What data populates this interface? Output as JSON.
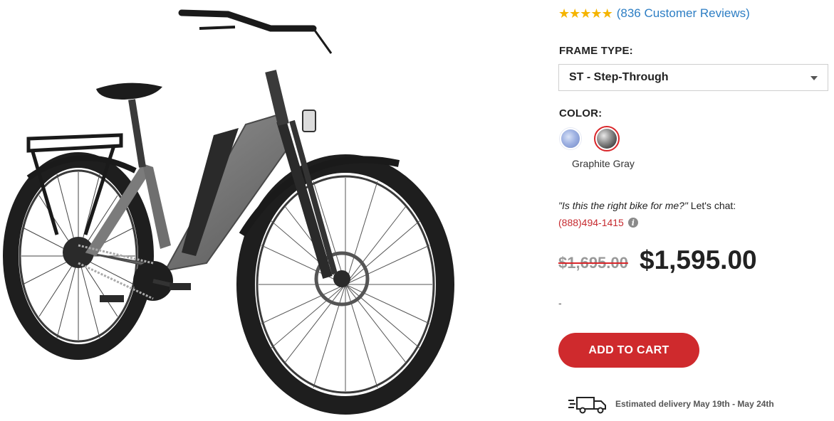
{
  "product": {
    "image_alt": "Graphite gray step-through electric bike"
  },
  "rating": {
    "stars": 5,
    "star_glyph": "★",
    "reviews_text": "(836 Customer Reviews)",
    "star_color": "#f5b400",
    "link_color": "#2d7ec4"
  },
  "frame": {
    "label": "FRAME TYPE:",
    "selected": "ST - Step-Through"
  },
  "color": {
    "label": "COLOR:",
    "options": [
      {
        "name": "Blue",
        "swatch": "#8fa3dc"
      },
      {
        "name": "Graphite Gray",
        "swatch": "#6b6b6b",
        "selected": true
      }
    ],
    "selected_name": "Graphite Gray"
  },
  "chat": {
    "question": "\"Is this the right bike for me?\"",
    "suffix": " Let's chat:",
    "phone": "(888)494-1415",
    "info_glyph": "i"
  },
  "price": {
    "original": "$1,695.00",
    "sale": "$1,595.00"
  },
  "misc": {
    "dash": "-"
  },
  "cart": {
    "button_label": "ADD TO CART",
    "button_color": "#cf2a2d"
  },
  "delivery": {
    "text": "Estimated delivery May 19th - May 24th",
    "icon": "delivery-truck-icon"
  }
}
